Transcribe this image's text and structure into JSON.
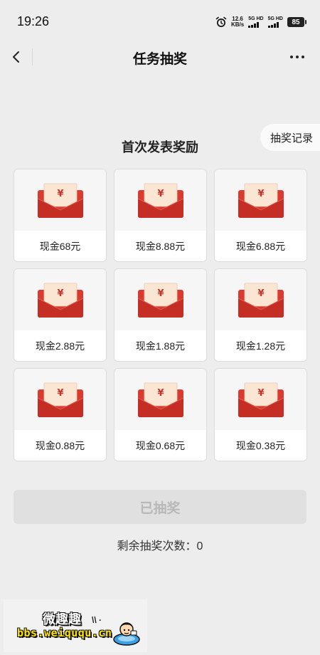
{
  "status_bar": {
    "time": "19:26",
    "net_speed_value": "12.6",
    "net_speed_unit": "KB/s",
    "sim1_label": "5G HD",
    "sim2_label": "5G HD",
    "battery": "85"
  },
  "header": {
    "title": "任务抽奖"
  },
  "records_button": "抽奖记录",
  "section_title": "首次发表奖励",
  "prizes": [
    {
      "label": "现金68元"
    },
    {
      "label": "现金8.88元"
    },
    {
      "label": "现金6.88元"
    },
    {
      "label": "现金2.88元"
    },
    {
      "label": "现金1.88元"
    },
    {
      "label": "现金1.28元"
    },
    {
      "label": "现金0.88元"
    },
    {
      "label": "现金0.68元"
    },
    {
      "label": "现金0.38元"
    }
  ],
  "prize_icon": "red-envelope-icon",
  "currency_symbol": "¥",
  "draw_button": "已抽奖",
  "remaining_label": "剩余抽奖次数：0",
  "watermark": {
    "cn": "微趣趣",
    "url": "bbs.weiququ.cn",
    "spark": "\\\\ ·"
  },
  "colors": {
    "envelope_red": "#d93b30",
    "envelope_flap": "#c42e25",
    "letter": "#fbe6d4",
    "disabled_button_bg": "#e0e0e0",
    "disabled_button_text": "#b8b8b8",
    "page_bg": "#ededed"
  }
}
